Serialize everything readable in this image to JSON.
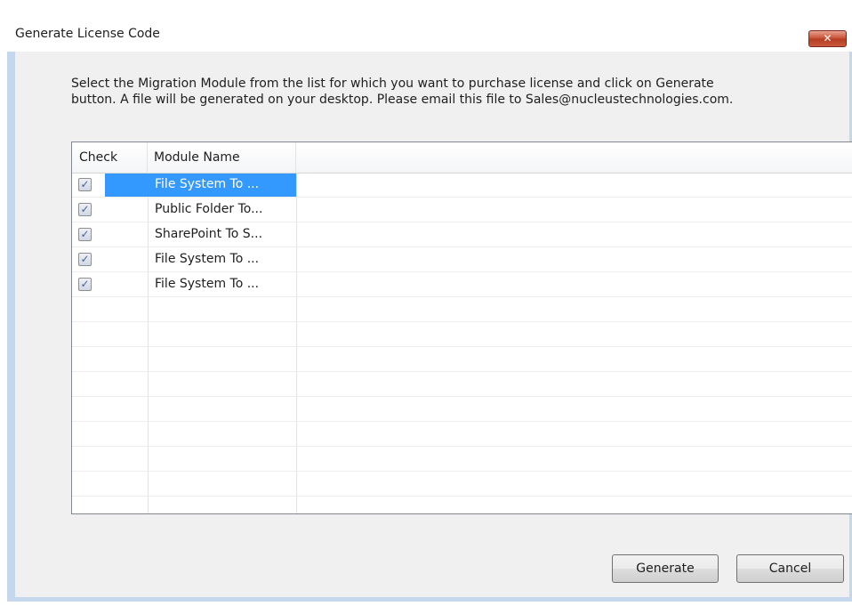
{
  "dialog": {
    "title": "Generate License Code",
    "close_symbol": "✕",
    "instruction_line1": "Select the Migration Module from the list for which you want to purchase license and click on Generate",
    "instruction_line2": "button. A file will be generated on your desktop. Please email this file to Sales@nucleustechnologies.com."
  },
  "list": {
    "columns": [
      "Check",
      "Module Name"
    ],
    "rows": [
      {
        "checked": true,
        "name": "File System To ...",
        "selected": true
      },
      {
        "checked": true,
        "name": "Public Folder To...",
        "selected": false
      },
      {
        "checked": true,
        "name": "SharePoint To S...",
        "selected": false
      },
      {
        "checked": true,
        "name": "File System To ...",
        "selected": false
      },
      {
        "checked": true,
        "name": "File System To ...",
        "selected": false
      }
    ],
    "check_mark": "✓",
    "selection_color": "#3399ff"
  },
  "buttons": {
    "generate": "Generate",
    "cancel": "Cancel"
  },
  "colors": {
    "frame": "#c4d7ec",
    "client": "#f0f0f0",
    "close_button": "#c75136"
  },
  "icons": {
    "close": "close-icon",
    "checkbox": "checkbox-checked-icon"
  }
}
